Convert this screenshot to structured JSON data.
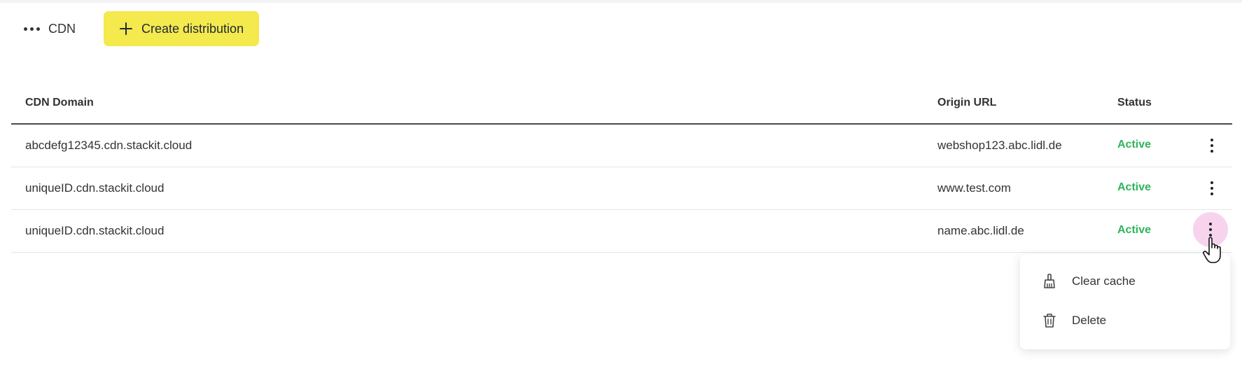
{
  "toolbar": {
    "breadcrumb_label": "CDN",
    "create_button_label": "Create distribution",
    "create_button_color": "#f4e94d"
  },
  "table": {
    "headers": {
      "domain": "CDN Domain",
      "origin": "Origin URL",
      "status": "Status"
    },
    "rows": [
      {
        "domain": "abcdefg12345.cdn.stackit.cloud",
        "origin": "webshop123.abc.lidl.de",
        "status": "Active"
      },
      {
        "domain": "uniqueID.cdn.stackit.cloud",
        "origin": "www.test.com",
        "status": "Active"
      },
      {
        "domain": "uniqueID.cdn.stackit.cloud",
        "origin": "name.abc.lidl.de",
        "status": "Active"
      }
    ]
  },
  "row_menu": {
    "items": [
      {
        "label": "Clear cache",
        "icon": "broom-icon"
      },
      {
        "label": "Delete",
        "icon": "trash-icon"
      }
    ]
  },
  "colors": {
    "status_active": "#2fb45a",
    "kebab_active_bg": "#f7d3ee"
  }
}
